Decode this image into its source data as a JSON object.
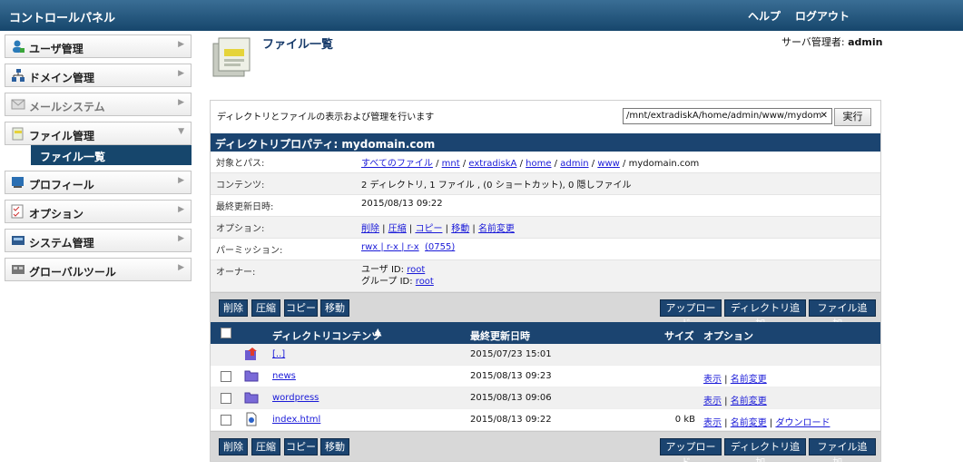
{
  "header": {
    "title": "コントロールパネル",
    "help": "ヘルプ",
    "logout": "ログアウト"
  },
  "sidebar": {
    "items": [
      {
        "label": "ユーザ管理",
        "icon": "user-icon"
      },
      {
        "label": "ドメイン管理",
        "icon": "domain-icon"
      },
      {
        "label": "メールシステム",
        "icon": "mail-icon"
      },
      {
        "label": "ファイル管理",
        "icon": "file-manager-icon",
        "sub": [
          "ファイル一覧"
        ]
      },
      {
        "label": "プロフィール",
        "icon": "profile-icon"
      },
      {
        "label": "オプション",
        "icon": "options-icon"
      },
      {
        "label": "システム管理",
        "icon": "system-icon"
      },
      {
        "label": "グローバルツール",
        "icon": "global-tools-icon"
      }
    ]
  },
  "page": {
    "title": "ファイル一覧",
    "admin_label": "サーバ管理者:",
    "admin_name": "admin",
    "intro": "ディレクトリとファイルの表示および管理を行います",
    "search_value": "/mnt/extradiskA/home/admin/www/mydom",
    "run_label": "実行"
  },
  "props": {
    "head": "ディレクトリプロパティ: mydomain.com",
    "path_label": "対象とパス:",
    "path": [
      "すべてのファイル",
      "mnt",
      "extradiskA",
      "home",
      "admin",
      "www"
    ],
    "path_current": "mydomain.com",
    "contents_label": "コンテンツ:",
    "contents": "2 ディレクトリ, 1 ファイル , (0 ショートカット), 0 隠しファイル",
    "modified_label": "最終更新日時:",
    "modified": "2015/08/13 09:22",
    "options_label": "オプション:",
    "options": [
      "削除",
      "圧縮",
      "コピー",
      "移動",
      "名前変更"
    ],
    "perm_label": "パーミッション:",
    "perm": "rwx | r-x | r-x",
    "perm_num": "(0755)",
    "owner_label": "オーナー:",
    "owner_user_label": "ユーザ ID:",
    "owner_user": "root",
    "owner_group_label": "グループ ID:",
    "owner_group": "root"
  },
  "toolbar": {
    "delete": "削除",
    "compress": "圧縮",
    "copy": "コピー",
    "move": "移動",
    "upload": "アップロード...",
    "add_dir": "ディレクトリ追加...",
    "add_file": "ファイル追加..."
  },
  "list": {
    "headers": {
      "name": "ディレクトリコンテンツ",
      "sort": "▲",
      "date": "最終更新日時",
      "size": "サイズ",
      "options": "オプション"
    },
    "rows": [
      {
        "name": "[..]",
        "date": "2015/07/23 15:01",
        "size": "",
        "opts": []
      },
      {
        "name": "news",
        "date": "2015/08/13 09:23",
        "size": "",
        "opts": [
          "表示",
          "名前変更"
        ]
      },
      {
        "name": "wordpress",
        "date": "2015/08/13 09:06",
        "size": "",
        "opts": [
          "表示",
          "名前変更"
        ]
      },
      {
        "name": "index.html",
        "date": "2015/08/13 09:22",
        "size": "0  kB",
        "opts": [
          "表示",
          "名前変更",
          "ダウンロード"
        ]
      }
    ]
  }
}
